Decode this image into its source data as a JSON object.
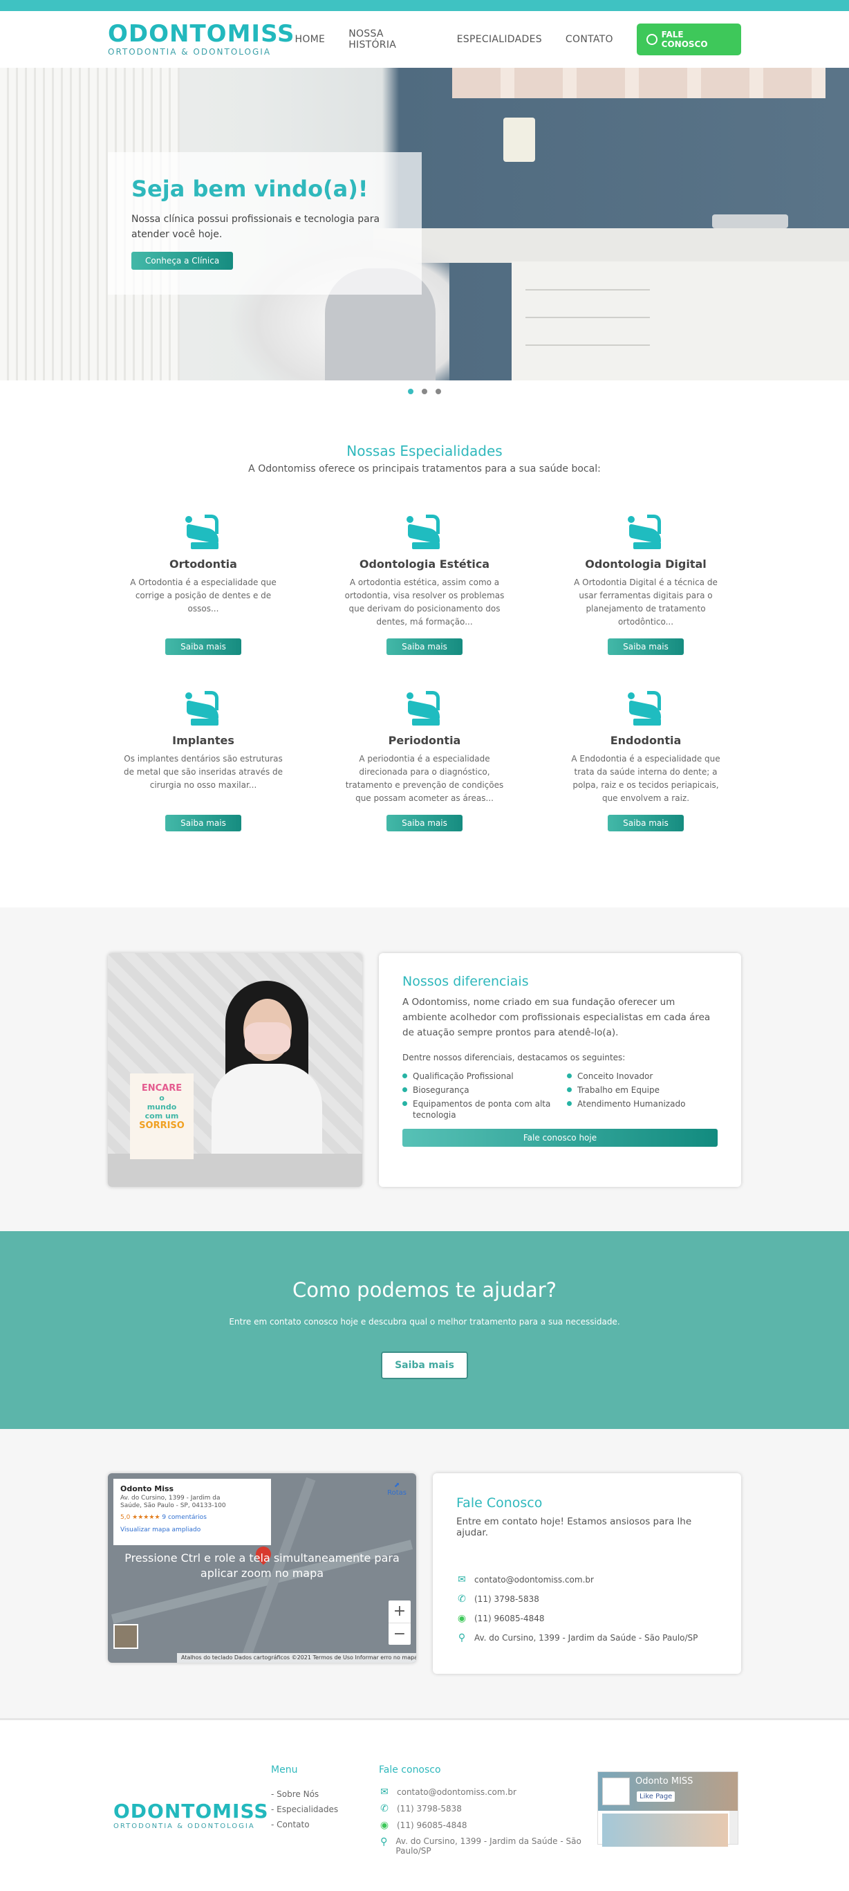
{
  "header": {
    "logo_main": "ODONTOMISS",
    "logo_sub": "ORTODONTIA & ODONTOLOGIA",
    "nav": [
      "HOME",
      "NOSSA HISTÓRIA",
      "ESPECIALIDADES",
      "CONTATO"
    ],
    "cta": "FALE CONOSCO"
  },
  "hero": {
    "title": "Seja bem vindo(a)!",
    "text": "Nossa clínica possui profissionais e tecnologia para atender você hoje.",
    "button": "Conheça a Clínica",
    "slides": 3,
    "active_slide": 1
  },
  "specialties": {
    "title": "Nossas Especialidades",
    "subtitle": "A Odontomiss oferece os principais tratamentos para a sua saúde bocal:",
    "button_label": "Saiba mais",
    "items": [
      {
        "title": "Ortodontia",
        "text": "A Ortodontia é a especialidade que corrige a posição de dentes e de ossos..."
      },
      {
        "title": "Odontologia Estética",
        "text": "A ortodontia estética, assim como a ortodontia, visa resolver os problemas que derivam do posicionamento dos dentes, má formação..."
      },
      {
        "title": "Odontologia Digital",
        "text": "A Ortodontia Digital é a técnica de usar ferramentas digitais para o planejamento de tratamento ortodôntico..."
      },
      {
        "title": "Implantes",
        "text": "Os implantes dentários são estruturas de metal que são inseridas através de cirurgia no osso maxilar..."
      },
      {
        "title": "Periodontia",
        "text": "A periodontia é a especialidade direcionada para o diagnóstico, tratamento e prevenção de condições que possam acometer as áreas..."
      },
      {
        "title": "Endodontia",
        "text": "A Endodontia é a especialidade que trata da saúde interna do dente; a polpa, raiz e os tecidos periapicais, que envolvem a raiz."
      }
    ]
  },
  "differentials": {
    "photo_text": [
      "ENCARE",
      "o",
      "mundo",
      "com um",
      "SORRISO"
    ],
    "title": "Nossos diferenciais",
    "lead": "A Odontomiss, nome criado em sua fundação oferecer um ambiente acolhedor com profissionais especialistas em cada área de atuação sempre prontos para atendê-lo(a).",
    "intro": "Dentre nossos diferenciais, destacamos os seguintes:",
    "list": [
      "Qualificação Profissional",
      "Conceito Inovador",
      "Biosegurança",
      "Trabalho em Equipe",
      "Equipamentos de ponta com alta tecnologia",
      "Atendimento Humanizado"
    ],
    "button": "Fale conosco hoje"
  },
  "help": {
    "title": "Como podemos te ajudar?",
    "text": "Entre em contato conosco hoje e descubra qual o melhor tratamento para a sua necessidade.",
    "button": "Saiba mais"
  },
  "map": {
    "name": "Odonto Miss",
    "address": "Av. do Cursino, 1399 - Jardim da Saúde, São Paulo - SP, 04133-100",
    "rating": "5,0 ★★★★★",
    "reviews": "9 comentários",
    "view_larger": "Visualizar mapa ampliado",
    "directions": "Rotas",
    "overlay": "Pressione Ctrl e role a tela simultaneamente para aplicar zoom no mapa",
    "zoom_in": "+",
    "zoom_out": "−",
    "footer": "Atalhos do teclado   Dados cartográficos ©2021   Termos de Uso   Informar erro no mapa"
  },
  "contact": {
    "title": "Fale Conosco",
    "lead": "Entre em contato hoje! Estamos ansiosos para lhe ajudar.",
    "email": "contato@odontomiss.com.br",
    "phone": "(11) 3798-5838",
    "whatsapp": "(11) 96085-4848",
    "address": "Av. do Cursino, 1399 - Jardim da Saúde - São Paulo/SP"
  },
  "footer": {
    "menu_title": "Menu",
    "menu": [
      "- Sobre Nós",
      "- Especialidades",
      "- Contato"
    ],
    "contact_title": "Fale conosco",
    "email": "contato@odontomiss.com.br",
    "phone": "(11) 3798-5838",
    "whatsapp": "(11) 96085-4848",
    "address": "Av. do Cursino, 1399 - Jardim da Saúde - São Paulo/SP",
    "fb_name": "Odonto MISS",
    "fb_like": "Like Page"
  },
  "colors": {
    "accent": "#2fb8bc",
    "whatsapp": "#3ec85a",
    "band": "#5cb5aa"
  }
}
